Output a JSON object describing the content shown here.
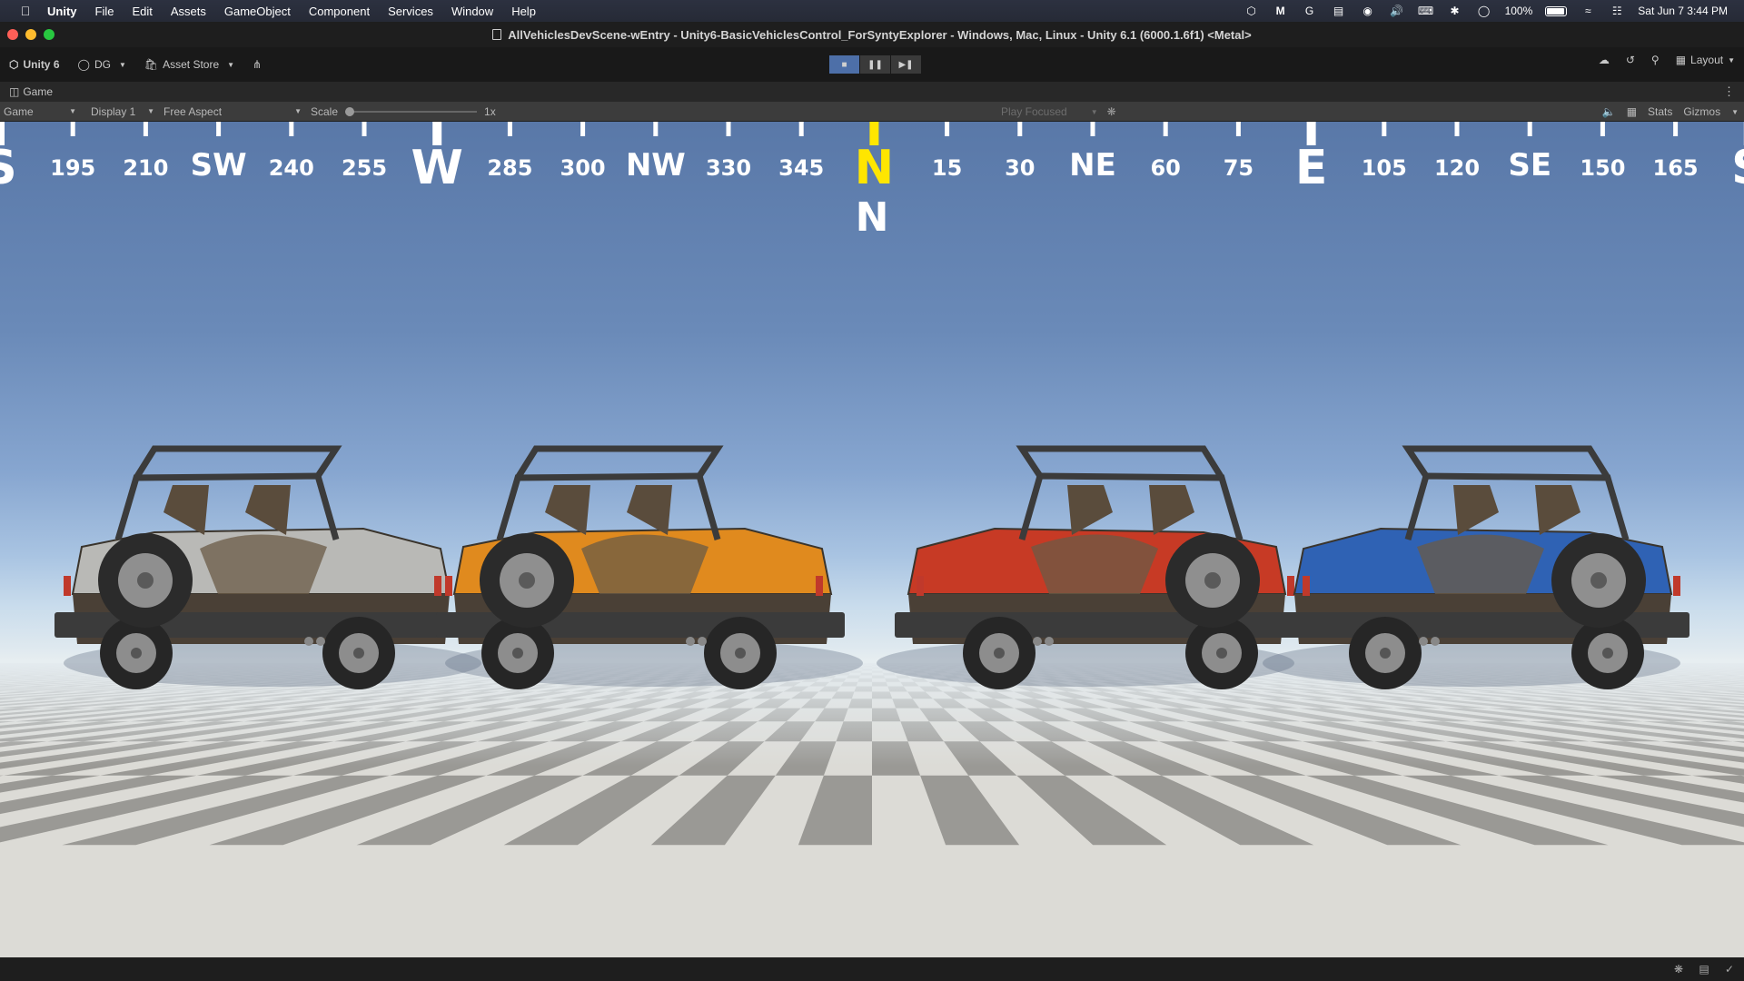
{
  "menubar": {
    "app": "Unity",
    "items": [
      "File",
      "Edit",
      "Assets",
      "GameObject",
      "Component",
      "Services",
      "Window",
      "Help"
    ],
    "battery_percent": "100%",
    "battery_level": 1.0,
    "datetime": "Sat Jun 7  3:44 PM",
    "tray_icons": [
      "unity-hub-icon",
      "malwarebytes-icon",
      "grammarly-icon",
      "docker-icon",
      "vpn-icon",
      "volume-icon",
      "keyboard-icon",
      "bluetooth-icon",
      "user-icon",
      "wifi-off-icon",
      "control-center-icon"
    ]
  },
  "window": {
    "title": "AllVehiclesDevScene-wEntry - Unity6-BasicVehiclesControl_ForSyntyExplorer - Windows, Mac, Linux - Unity 6.1 (6000.1.6f1) <Metal>"
  },
  "toolbar": {
    "unity_version": "Unity 6",
    "account": "DG",
    "asset_store": "Asset Store",
    "layout": "Layout"
  },
  "tab": {
    "label": "Game"
  },
  "gamebar": {
    "view": "Game",
    "display": "Display 1",
    "aspect": "Free Aspect",
    "scale_label": "Scale",
    "scale_value": "1x",
    "play_mode": "Play Focused",
    "stats": "Stats",
    "gizmos": "Gizmos"
  },
  "compass": {
    "heading_label": "N",
    "ticks": [
      "S",
      "195",
      "210",
      "SW",
      "240",
      "255",
      "W",
      "285",
      "300",
      "NW",
      "330",
      "345",
      "N",
      "15",
      "30",
      "NE",
      "60",
      "75",
      "E",
      "105",
      "120",
      "SE",
      "150",
      "165",
      "S"
    ]
  },
  "scene": {
    "vehicle_colors": [
      "#b9b9b6",
      "#e08a1e",
      "#c73a25",
      "#2f62b4"
    ],
    "sky_color": "#5978a8",
    "floor_light": "#dcdbd6",
    "floor_dark": "#9a9995"
  }
}
